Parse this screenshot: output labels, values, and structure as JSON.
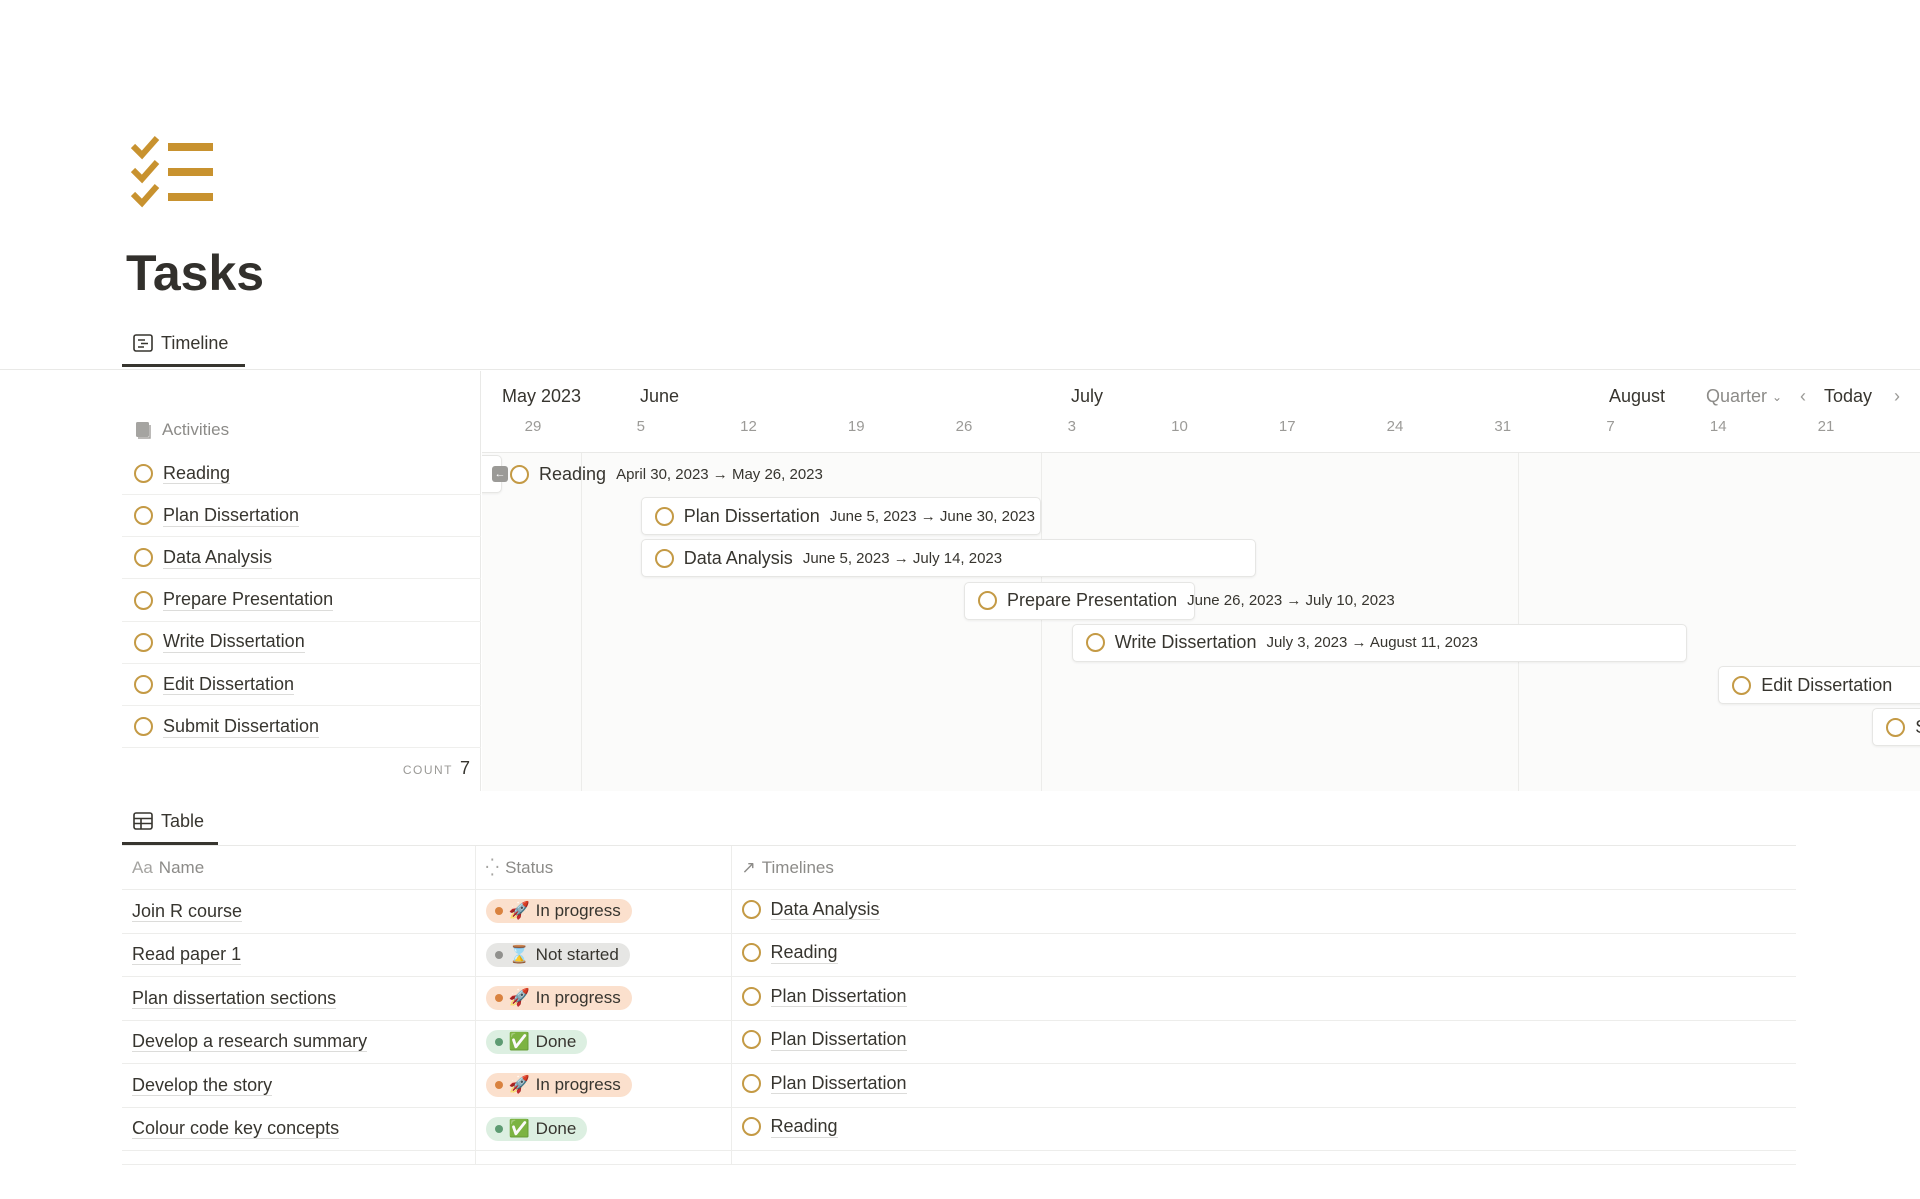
{
  "page": {
    "title": "Tasks",
    "icon": "checklist-icon",
    "accent": "#c8922f"
  },
  "timeline_view": {
    "tab_label": "Timeline",
    "group_label": "Activities",
    "count_label": "COUNT",
    "count_value": "7",
    "months": [
      {
        "label": "May 2023"
      },
      {
        "label": "June"
      },
      {
        "label": "July"
      },
      {
        "label": "August"
      }
    ],
    "days": [
      "29",
      "5",
      "12",
      "19",
      "26",
      "3",
      "10",
      "17",
      "24",
      "31",
      "7",
      "14",
      "21"
    ],
    "zoom_select": "Quarter",
    "today_label": "Today",
    "items": [
      {
        "name": "Reading",
        "start": "2023-04-30",
        "end": "2023-05-26",
        "dates": "April 30, 2023 → May 26, 2023"
      },
      {
        "name": "Plan Dissertation",
        "start": "2023-06-05",
        "end": "2023-06-30",
        "dates": "June 5, 2023 → June 30, 2023"
      },
      {
        "name": "Data Analysis",
        "start": "2023-06-05",
        "end": "2023-07-14",
        "dates": "June 5, 2023 → July 14, 2023"
      },
      {
        "name": "Prepare Presentation",
        "start": "2023-06-26",
        "end": "2023-07-10",
        "dates": "June 26, 2023 → July 10, 2023"
      },
      {
        "name": "Write Dissertation",
        "start": "2023-07-03",
        "end": "2023-08-11",
        "dates": "July 3, 2023 → August 11, 2023"
      },
      {
        "name": "Edit Dissertation",
        "start": "2023-08-14",
        "dates": ""
      },
      {
        "name": "Submit Dissertation",
        "start": "2023-08-24",
        "dates": ""
      }
    ]
  },
  "table_view": {
    "tab_label": "Table",
    "columns": [
      {
        "label": "Name",
        "icon": "text-icon"
      },
      {
        "label": "Status",
        "icon": "status-icon"
      },
      {
        "label": "Timelines",
        "icon": "relation-arrow-icon"
      }
    ],
    "rows": [
      {
        "name": "Join R course",
        "status": "In progress",
        "emoji": "🚀",
        "timeline": "Data Analysis"
      },
      {
        "name": "Read paper 1",
        "status": "Not started",
        "emoji": "⌛",
        "timeline": "Reading"
      },
      {
        "name": "Plan dissertation sections",
        "status": "In progress",
        "emoji": "🚀",
        "timeline": "Plan Dissertation"
      },
      {
        "name": "Develop a research summary",
        "status": "Done",
        "emoji": "✅",
        "timeline": "Plan Dissertation"
      },
      {
        "name": "Develop the story",
        "status": "In progress",
        "emoji": "🚀",
        "timeline": "Plan Dissertation"
      },
      {
        "name": "Colour code key concepts",
        "status": "Done",
        "emoji": "✅",
        "timeline": "Reading"
      }
    ],
    "status_colors": {
      "In progress": {
        "bg": "#fbe0cd",
        "dot": "#d9823f"
      },
      "Not started": {
        "bg": "#e6e6e4",
        "dot": "#91918e"
      },
      "Done": {
        "bg": "#dcefe1",
        "dot": "#5d9b72"
      }
    }
  }
}
